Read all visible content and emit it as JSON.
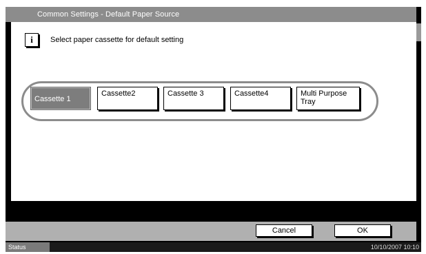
{
  "window": {
    "title": "Common Settings - Default Paper Source"
  },
  "main": {
    "message": "Select paper cassette for default setting",
    "info_icon": "i",
    "options": [
      {
        "label": "Cassette 1",
        "selected": true
      },
      {
        "label": "Cassette2",
        "selected": false
      },
      {
        "label": "Cassette 3",
        "selected": false
      },
      {
        "label": "Cassette4",
        "selected": false
      },
      {
        "label": "Multi Purpose Tray",
        "selected": false
      }
    ]
  },
  "actions": {
    "cancel_label": "Cancel",
    "ok_label": "OK"
  },
  "status_bar": {
    "status_label": "Status",
    "datetime": "10/10/2007   10:10"
  },
  "colors": {
    "selected": "#7d7d7d",
    "title_bar": "#8c8c8c",
    "bottom_bar": "#b0b0b0"
  }
}
